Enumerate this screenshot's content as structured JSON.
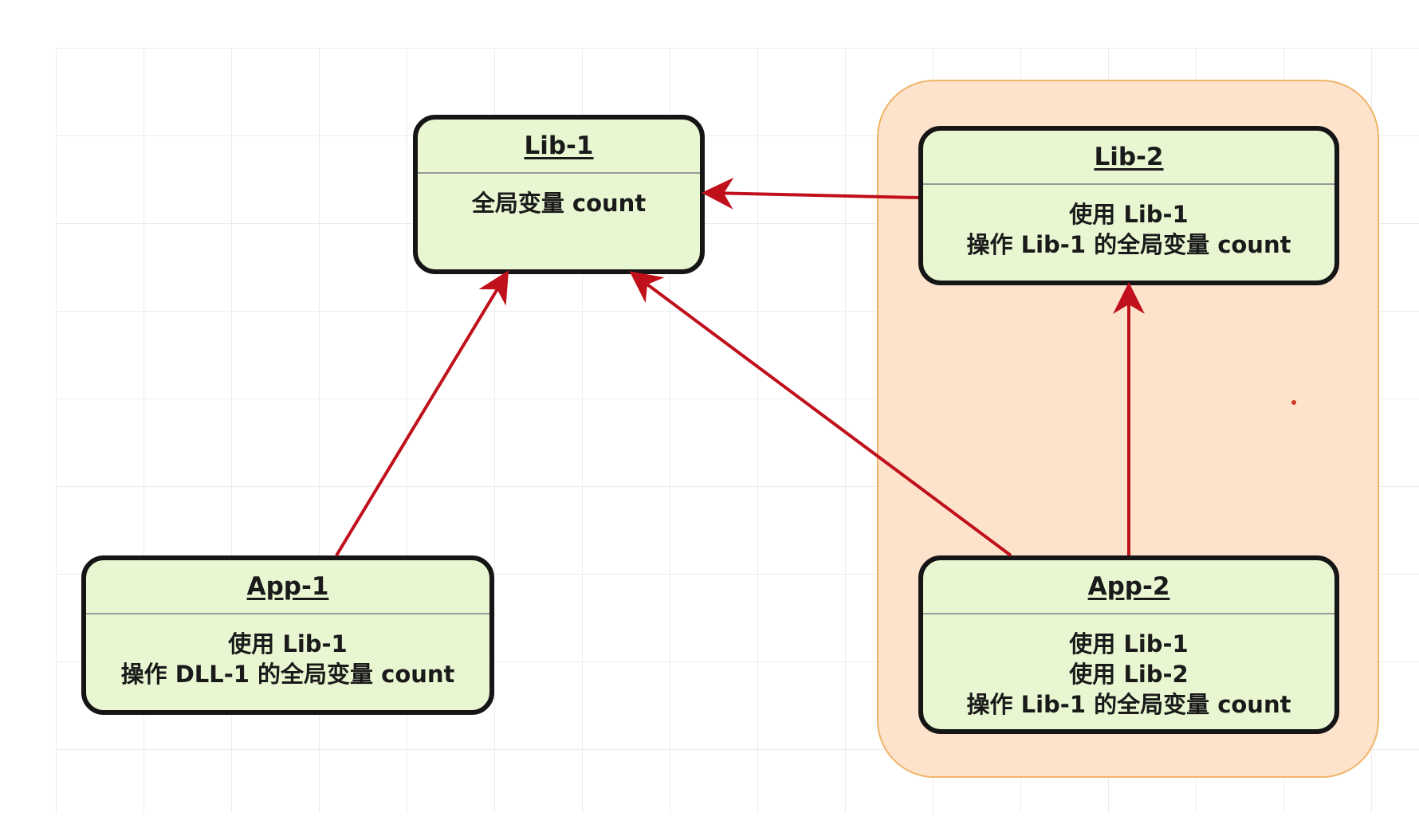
{
  "nodes": {
    "lib1": {
      "title": "Lib-1",
      "lines": [
        "全局变量 count"
      ]
    },
    "lib2": {
      "title": "Lib-2",
      "lines": [
        "使用 Lib-1",
        "操作 Lib-1 的全局变量 count"
      ]
    },
    "app1": {
      "title": "App-1",
      "lines": [
        "使用 Lib-1",
        "操作 DLL-1 的全局变量 count"
      ]
    },
    "app2": {
      "title": "App-2",
      "lines": [
        "使用 Lib-1",
        "使用 Lib-2",
        "操作 Lib-1 的全局变量 count"
      ]
    }
  },
  "edges": [
    {
      "from": "lib2",
      "to": "lib1"
    },
    {
      "from": "app1",
      "to": "lib1"
    },
    {
      "from": "app2",
      "to": "lib1"
    },
    {
      "from": "app2",
      "to": "lib2"
    }
  ],
  "colors": {
    "node_fill": "#e8f7d2",
    "node_border": "#151515",
    "group_fill": "#fde3cc",
    "group_border": "#f0b468",
    "arrow": "#c0101c"
  }
}
